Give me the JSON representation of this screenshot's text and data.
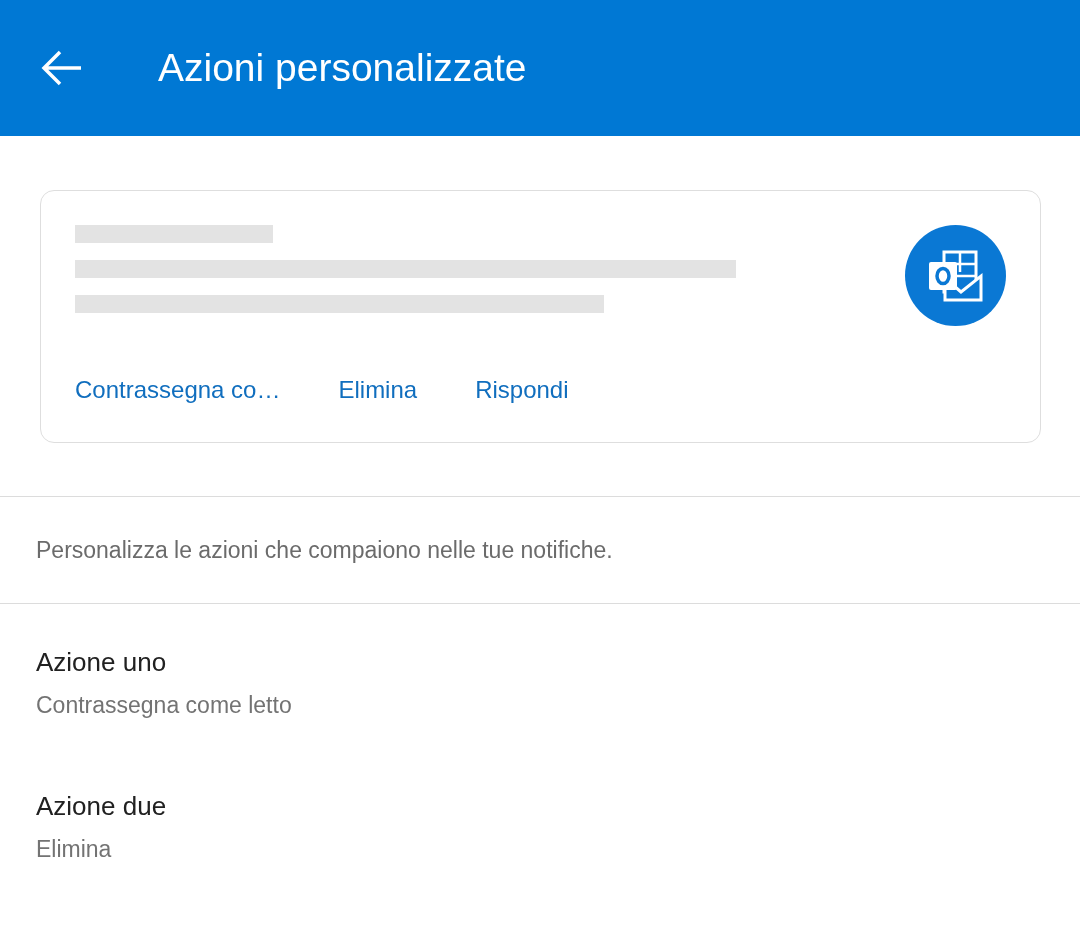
{
  "header": {
    "title": "Azioni personalizzate"
  },
  "preview": {
    "actions": [
      "Contrassegna co…",
      "Elimina",
      "Rispondi"
    ]
  },
  "description": "Personalizza le azioni che compaiono nelle tue notifiche.",
  "settings": [
    {
      "title": "Azione uno",
      "value": "Contrassegna come letto"
    },
    {
      "title": "Azione due",
      "value": "Elimina"
    }
  ]
}
